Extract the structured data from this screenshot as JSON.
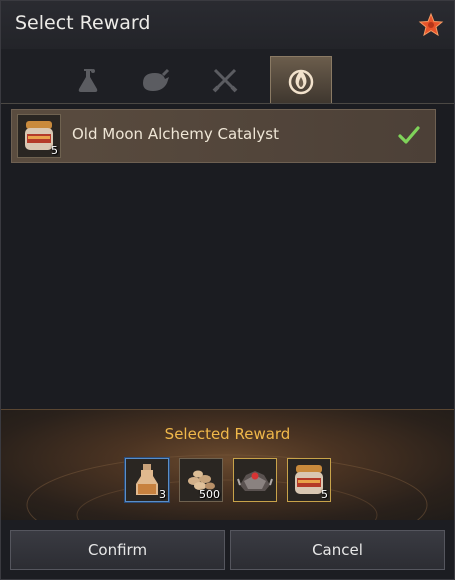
{
  "window": {
    "title": "Select Reward"
  },
  "tabs": [
    {
      "icon": "flask-icon",
      "active": false
    },
    {
      "icon": "roast-meat-icon",
      "active": false
    },
    {
      "icon": "crossed-swords-icon",
      "active": false
    },
    {
      "icon": "flame-icon",
      "active": true
    }
  ],
  "reward_list": {
    "items": [
      {
        "label": "Old Moon Alchemy Catalyst",
        "quantity": "5",
        "icon": "catalyst-jar-icon",
        "selected": true
      }
    ]
  },
  "selected_panel": {
    "title": "Selected Reward",
    "slots": [
      {
        "icon": "potion-bottle-icon",
        "quantity": "3"
      },
      {
        "icon": "silver-coins-icon",
        "quantity": "500"
      },
      {
        "icon": "dark-armor-icon",
        "quantity": ""
      },
      {
        "icon": "catalyst-jar-icon",
        "quantity": "5"
      }
    ]
  },
  "buttons": {
    "confirm": "Confirm",
    "cancel": "Cancel"
  },
  "colors": {
    "accent_gold": "#f0b84a",
    "check_green": "#7fd35a",
    "selected_row": "#5a4c3f"
  }
}
